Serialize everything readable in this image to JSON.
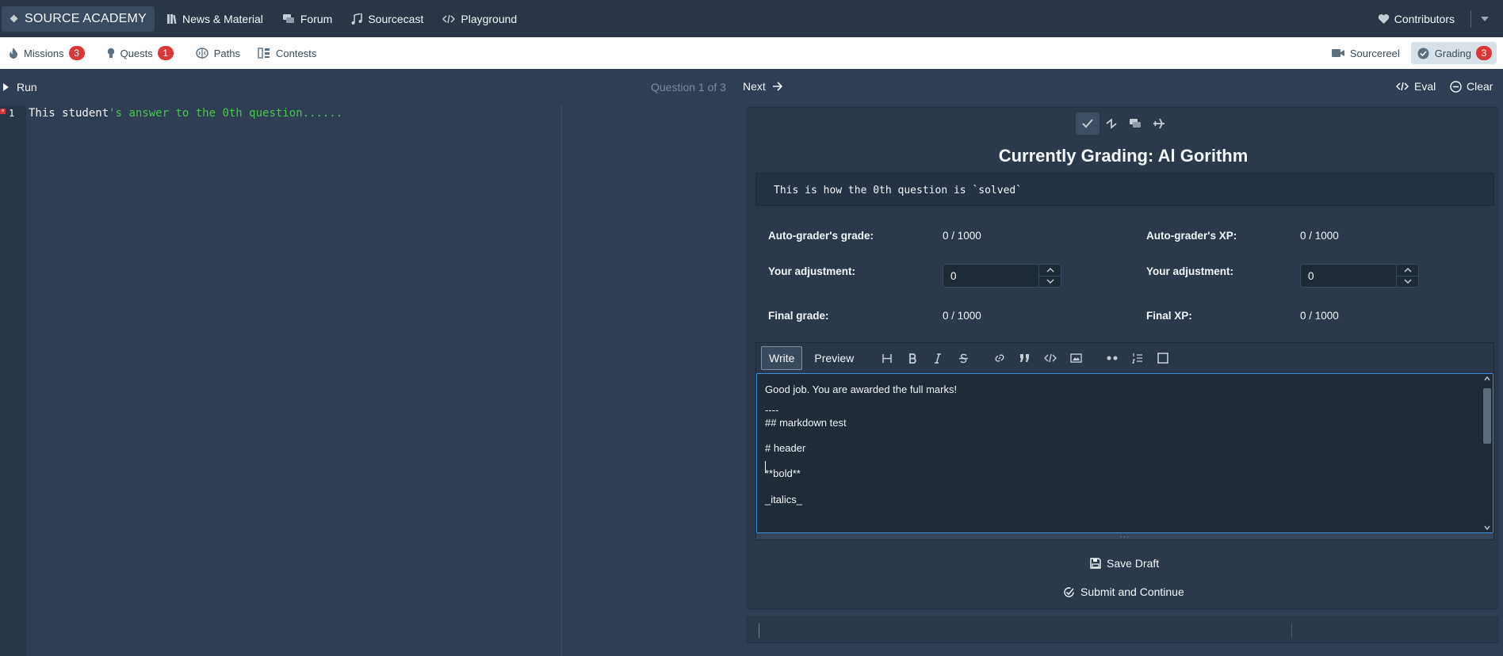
{
  "topbar": {
    "brand": "SOURCE ACADEMY",
    "nav": [
      "News & Material",
      "Forum",
      "Sourcecast",
      "Playground"
    ],
    "contributors": "Contributors"
  },
  "subbar": {
    "missions": {
      "label": "Missions",
      "count": "3"
    },
    "quests": {
      "label": "Quests",
      "count": "1"
    },
    "paths": "Paths",
    "contests": "Contests",
    "sourcereel": "Sourcereel",
    "grading": {
      "label": "Grading",
      "count": "3"
    }
  },
  "controls": {
    "run": "Run",
    "question_counter": "Question 1 of 3",
    "next": "Next",
    "eval": "Eval",
    "clear": "Clear"
  },
  "editor": {
    "line_number": "1",
    "code_plain": "This student",
    "code_string": "'s answer to the 0th question......"
  },
  "grading": {
    "title": "Currently Grading: Al Gorithm",
    "solution": "This is how the 0th question is `solved`",
    "autograder_grade_label": "Auto-grader's grade:",
    "autograder_grade_value": "0 / 1000",
    "autograder_xp_label": "Auto-grader's XP:",
    "autograder_xp_value": "0 / 1000",
    "adjust_grade_label": "Your adjustment:",
    "adjust_grade_value": "0",
    "adjust_xp_label": "Your adjustment:",
    "adjust_xp_value": "0",
    "final_grade_label": "Final grade:",
    "final_grade_value": "0 / 1000",
    "final_xp_label": "Final XP:",
    "final_xp_value": "0 / 1000"
  },
  "markdown": {
    "tab_write": "Write",
    "tab_preview": "Preview",
    "lines": [
      "Good job. You are awarded the full marks!",
      "",
      "----",
      "## markdown test",
      "",
      "# header",
      "",
      "**bold**",
      "",
      "_italics_"
    ]
  },
  "actions": {
    "save_draft": "Save Draft",
    "submit": "Submit and Continue"
  }
}
